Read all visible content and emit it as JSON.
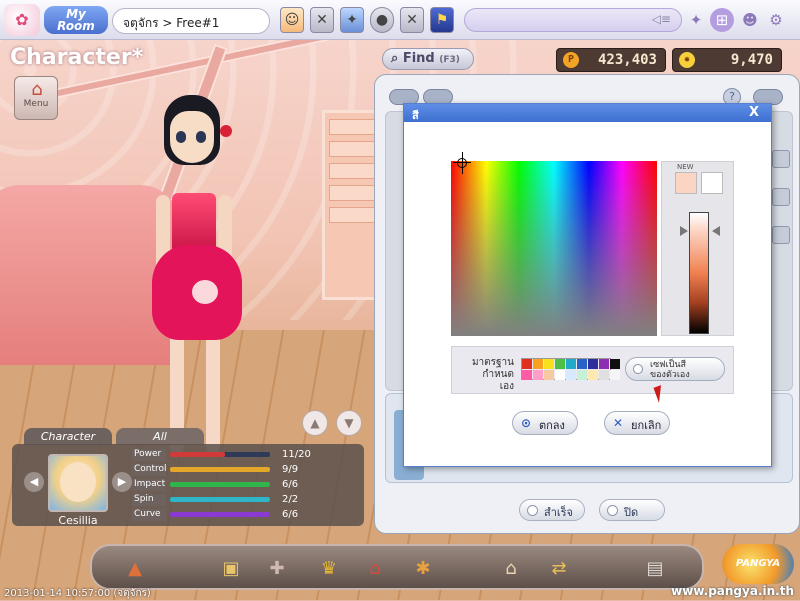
{
  "topbar": {
    "myroom_label": "My Room",
    "location": "จตุจักร > Free#1",
    "chat_placeholder": ""
  },
  "screen": {
    "title": "Character",
    "title_suffix": "*",
    "menu_label": "Menu",
    "find_label": "Find",
    "find_shortcut": "(F3)"
  },
  "currency": {
    "pang": "423,403",
    "cookie": "9,470"
  },
  "char_panel": {
    "tabs": [
      "Character",
      "All"
    ],
    "name": "Cesillia",
    "stats": [
      {
        "label": "Power",
        "value": "11/20",
        "fill": 0.55,
        "color": "#d23a3a"
      },
      {
        "label": "Control",
        "value": "9/9",
        "fill": 1.0,
        "color": "#e4a72a"
      },
      {
        "label": "Impact",
        "value": "6/6",
        "fill": 1.0,
        "color": "#2fb54a"
      },
      {
        "label": "Spin",
        "value": "2/2",
        "fill": 1.0,
        "color": "#2fb5c8"
      },
      {
        "label": "Curve",
        "value": "6/6",
        "fill": 1.0,
        "color": "#8a3ad0"
      }
    ]
  },
  "main_panel": {
    "finish_label": "สำเร็จ",
    "close_label": "ปิด"
  },
  "color_dialog": {
    "title": "สี",
    "close_glyph": "X",
    "new_label": "NEW",
    "standard_label": "มาตรฐาน\nกำหนดเอง",
    "custom_button": "เซฟเป็นสี\nของตัวเอง",
    "ok_label": "ตกลง",
    "cancel_label": "ยกเลิก",
    "current_color": "#fcd4c3",
    "previous_color": "#ffffff",
    "swatches": [
      "#e0301e",
      "#f7a11e",
      "#f7e11e",
      "#4dbf46",
      "#22a8c9",
      "#2862c9",
      "#2d2d9c",
      "#8d2db4",
      "#101010",
      "#ff5aa5",
      "#ff9ec8",
      "#f7c9a3",
      "#ffffff",
      "#d6e9ff",
      "#c6f0d8",
      "#ffe9b0",
      "#e0e0e0",
      "#f5f5f5"
    ]
  },
  "footer": {
    "timestamp": "2013-01-14 10:57:00 (จตุจักร)",
    "website": "www.pangya.in.th",
    "logo_text": "PANGYA"
  },
  "icons": {
    "logo": "bunny-logo-icon",
    "settings": "gear-icon",
    "find": "search-icon",
    "menu": "house-icon"
  }
}
